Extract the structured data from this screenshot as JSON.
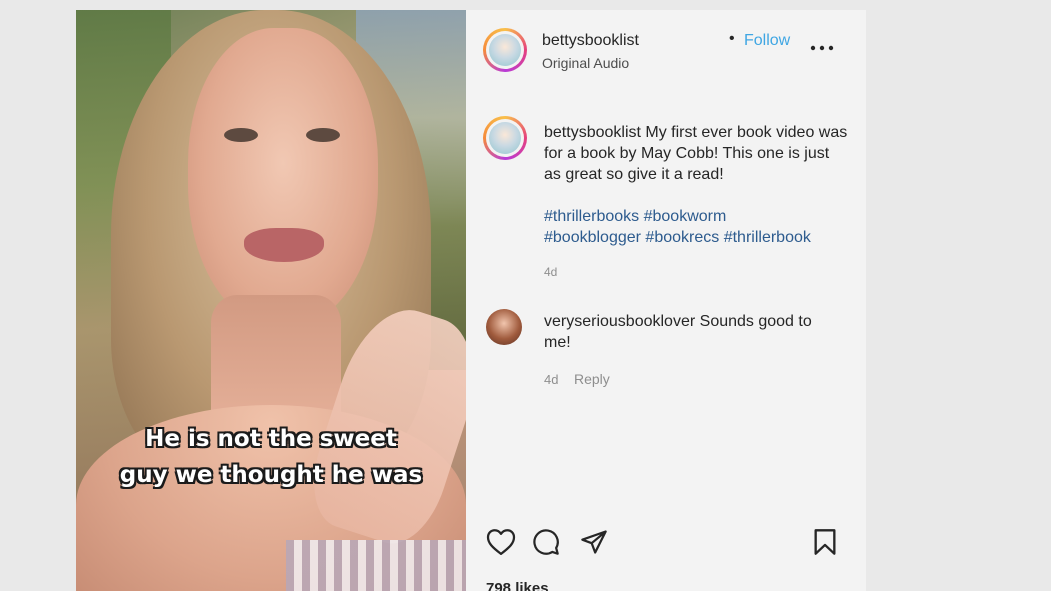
{
  "header": {
    "username": "bettysbooklist",
    "separator": "•",
    "follow_label": "Follow",
    "audio_label": "Original Audio",
    "more_icon": "more-options-icon"
  },
  "media": {
    "overlay_line1": "He is not the sweet",
    "overlay_line2": "guy we thought he was"
  },
  "caption": {
    "username": "bettysbooklist",
    "text": "My first ever book video was for a book by May Cobb! This one is just as great so give it a read!",
    "hashtags": [
      "#thrillerbooks",
      "#bookworm",
      "#bookblogger",
      "#bookrecs",
      "#thrillerbook"
    ],
    "time": "4d"
  },
  "comments": [
    {
      "username": "veryseriousbooklover",
      "text": "Sounds good to me!",
      "time": "4d",
      "reply_label": "Reply"
    }
  ],
  "actions": {
    "icons": [
      "heart-icon",
      "comment-icon",
      "share-icon",
      "bookmark-icon"
    ]
  },
  "likes_label": "798 likes",
  "colors": {
    "follow": "#3fa6e3",
    "hashtag": "#2d5b8e",
    "muted": "#8e8e8e",
    "panel_bg": "#f3f3f3",
    "page_bg": "#e9e9e9"
  }
}
